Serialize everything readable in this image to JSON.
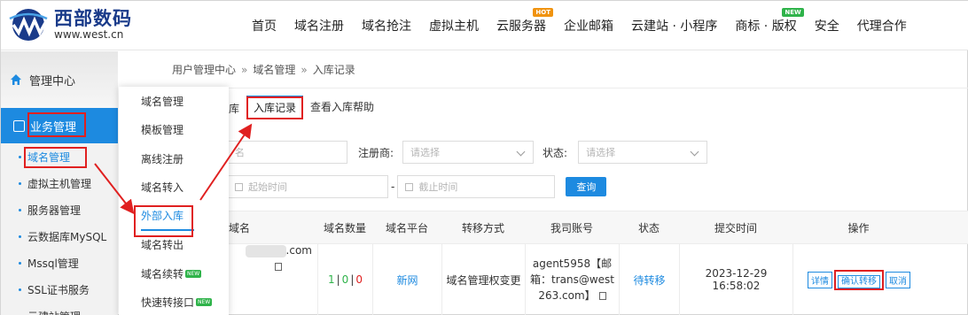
{
  "header": {
    "logo_cn": "西部数码",
    "logo_en": "www.west.cn",
    "nav": [
      {
        "label": "首页"
      },
      {
        "label": "域名注册"
      },
      {
        "label": "域名抢注"
      },
      {
        "label": "虚拟主机"
      },
      {
        "label": "云服务器",
        "badge": "HOT"
      },
      {
        "label": "企业邮箱"
      },
      {
        "label": "云建站 · 小程序"
      },
      {
        "label": "商标 · 版权",
        "badge": "NEW"
      },
      {
        "label": "安全"
      },
      {
        "label": "代理合作"
      }
    ]
  },
  "sidebar": {
    "home": "管理中心",
    "section": "业务管理",
    "items": [
      "域名管理",
      "虚拟主机管理",
      "服务器管理",
      "云数据库MySQL",
      "Mssql管理",
      "SSL证书服务",
      "云建站管理"
    ]
  },
  "flyout": {
    "items": [
      "域名管理",
      "模板管理",
      "离线注册",
      "域名转入",
      "外部入库",
      "域名转出",
      "域名续转",
      "快速转接口"
    ],
    "new_tags": [
      "NEW",
      "NEW"
    ]
  },
  "breadcrumb": {
    "parts": [
      "用户管理中心",
      "域名管理",
      "入库记录"
    ],
    "sep": "»"
  },
  "tabs": {
    "partial": "库",
    "active": "入库记录",
    "help": "查看入库帮助"
  },
  "filters": {
    "domain_placeholder": "名",
    "registrar_label": "注册商:",
    "registrar_placeholder": "请选择",
    "status_label": "状态:",
    "status_placeholder": "请选择",
    "start_placeholder": "起始时间",
    "dash": "-",
    "end_placeholder": "截止时间",
    "query_button": "查询"
  },
  "table": {
    "headers": [
      "域名",
      "域名数量",
      "域名平台",
      "转移方式",
      "我司账号",
      "状态",
      "提交时间",
      "操作"
    ],
    "row": {
      "domain_suffix": ".com",
      "count_a": "1",
      "count_sep1": "|",
      "count_b": "0",
      "count_sep2": "|",
      "count_c": "0",
      "platform": "新网",
      "method": "域名管理权变更",
      "account_line1": "agent5958【邮",
      "account_line2": "箱：trans@west",
      "account_line3": "263.com】",
      "status": "待转移",
      "time": "2023-12-29 16:58:02",
      "op_detail": "详情",
      "op_confirm": "确认转移",
      "op_cancel": "取消"
    }
  },
  "colors": {
    "primary": "#1d8ae0",
    "annotation": "#e02020",
    "brand": "#1a3b8a"
  }
}
